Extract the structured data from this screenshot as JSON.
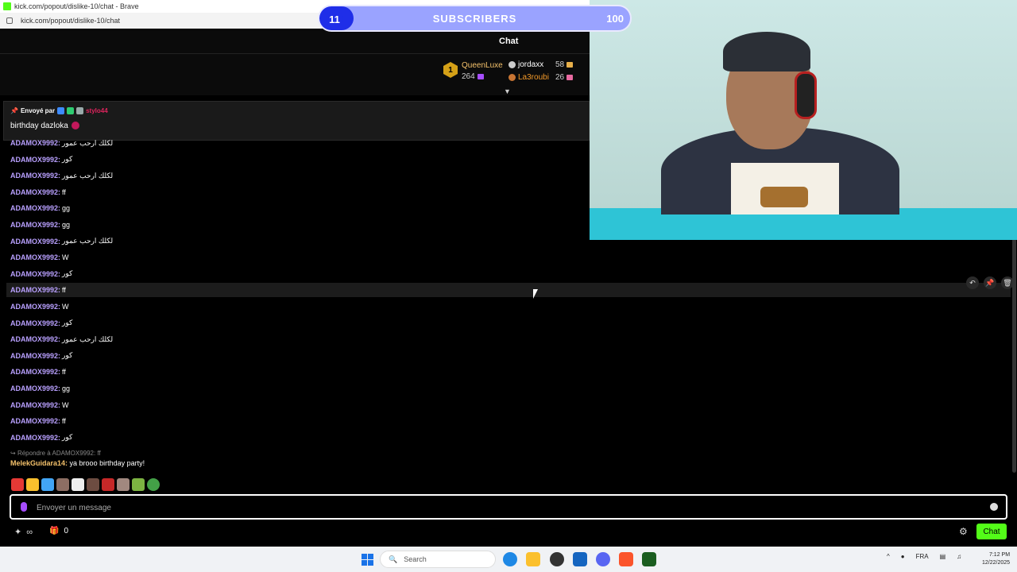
{
  "browser": {
    "title": "kick.com/popout/dislike-10/chat - Brave",
    "url": "kick.com/popout/dislike-10/chat"
  },
  "sub_goal": {
    "current": "11",
    "label": "SUBSCRIBERS",
    "goal": "100",
    "progress_fraction": 0.11
  },
  "chat_header": {
    "title": "Chat"
  },
  "leaderboard": {
    "top": {
      "rank": "1",
      "name": "QueenLuxe",
      "count": "264"
    },
    "others": [
      {
        "name": "jordaxx",
        "count": "58"
      },
      {
        "name": "La3roubi",
        "count": "26"
      }
    ]
  },
  "pinned": {
    "sent_by_label": "Envoyé par",
    "sender": "stylo44",
    "message": "birthday dazloka"
  },
  "messages": [
    {
      "user": "ADAMOX9992:",
      "text": "لكلك ارحب عمور"
    },
    {
      "user": "ADAMOX9992:",
      "text": "كور"
    },
    {
      "user": "ADAMOX9992:",
      "text": "لكلك ارحب عمور"
    },
    {
      "user": "ADAMOX9992:",
      "text": "ff"
    },
    {
      "user": "ADAMOX9992:",
      "text": "gg"
    },
    {
      "user": "ADAMOX9992:",
      "text": "gg"
    },
    {
      "user": "ADAMOX9992:",
      "text": "لكلك ارحب عمور"
    },
    {
      "user": "ADAMOX9992:",
      "text": "W"
    },
    {
      "user": "ADAMOX9992:",
      "text": "كور"
    },
    {
      "user": "ADAMOX9992:",
      "text": "ff"
    },
    {
      "user": "ADAMOX9992:",
      "text": "W"
    },
    {
      "user": "ADAMOX9992:",
      "text": "كور"
    },
    {
      "user": "ADAMOX9992:",
      "text": "لكلك ارحب عمور"
    },
    {
      "user": "ADAMOX9992:",
      "text": "كور"
    },
    {
      "user": "ADAMOX9992:",
      "text": "ff"
    },
    {
      "user": "ADAMOX9992:",
      "text": "gg"
    },
    {
      "user": "ADAMOX9992:",
      "text": "W"
    },
    {
      "user": "ADAMOX9992:",
      "text": "ff"
    },
    {
      "user": "ADAMOX9992:",
      "text": "كور"
    }
  ],
  "reply": {
    "reference": "Répondre à ADAMOX9992: ff",
    "user": "MelekGuidara14:",
    "text": "ya brooo birthday party!"
  },
  "input": {
    "placeholder": "Envoyer un message"
  },
  "footer": {
    "gift_count": "0",
    "chat_button": "Chat"
  },
  "taskbar": {
    "search_label": "Search",
    "language": "FRA",
    "time": "7:12 PM",
    "date": "12/22/2025"
  },
  "colors": {
    "kick_green": "#53fc18",
    "username_purple": "#b9a0ff",
    "sub_bar_blue": "#1f2ee8"
  }
}
